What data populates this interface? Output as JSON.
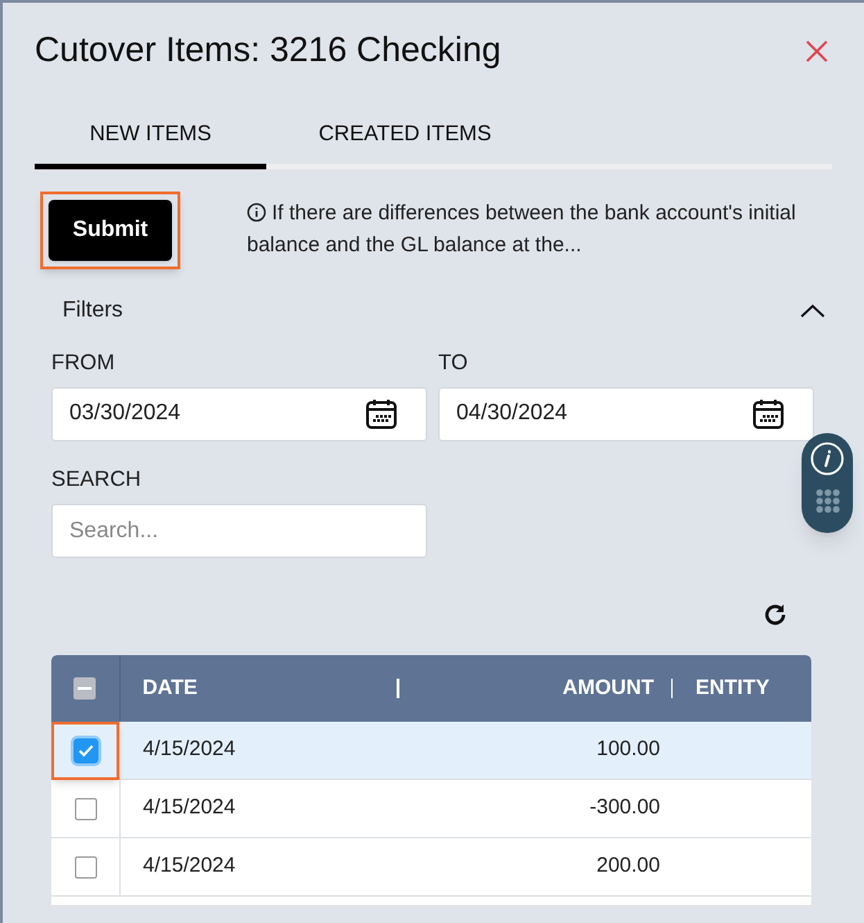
{
  "dialog": {
    "title": "Cutover Items: 3216 Checking"
  },
  "tabs": [
    {
      "label": "NEW ITEMS",
      "selected": true
    },
    {
      "label": "CREATED ITEMS",
      "selected": false
    }
  ],
  "submit": {
    "label": "Submit",
    "highlighted": true
  },
  "info": "If there are differences between the bank account's initial balance and the GL balance at the...",
  "filters": {
    "title": "Filters",
    "expanded": true,
    "from": {
      "label": "FROM",
      "value": "03/30/2024"
    },
    "to": {
      "label": "TO",
      "value": "04/30/2024"
    },
    "search": {
      "label": "SEARCH",
      "placeholder": "Search..."
    }
  },
  "table": {
    "header_checkbox": {
      "indeterminate": true
    },
    "columns": [
      "DATE",
      "AMOUNT",
      "ENTITY"
    ],
    "rows": [
      {
        "date": "4/15/2024",
        "amount": "100.00",
        "selected": true,
        "highlighted": true
      },
      {
        "date": "4/15/2024",
        "amount": "-300.00",
        "selected": false,
        "highlighted": false
      },
      {
        "date": "4/15/2024",
        "amount": "200.00",
        "selected": false,
        "highlighted": false
      }
    ]
  }
}
